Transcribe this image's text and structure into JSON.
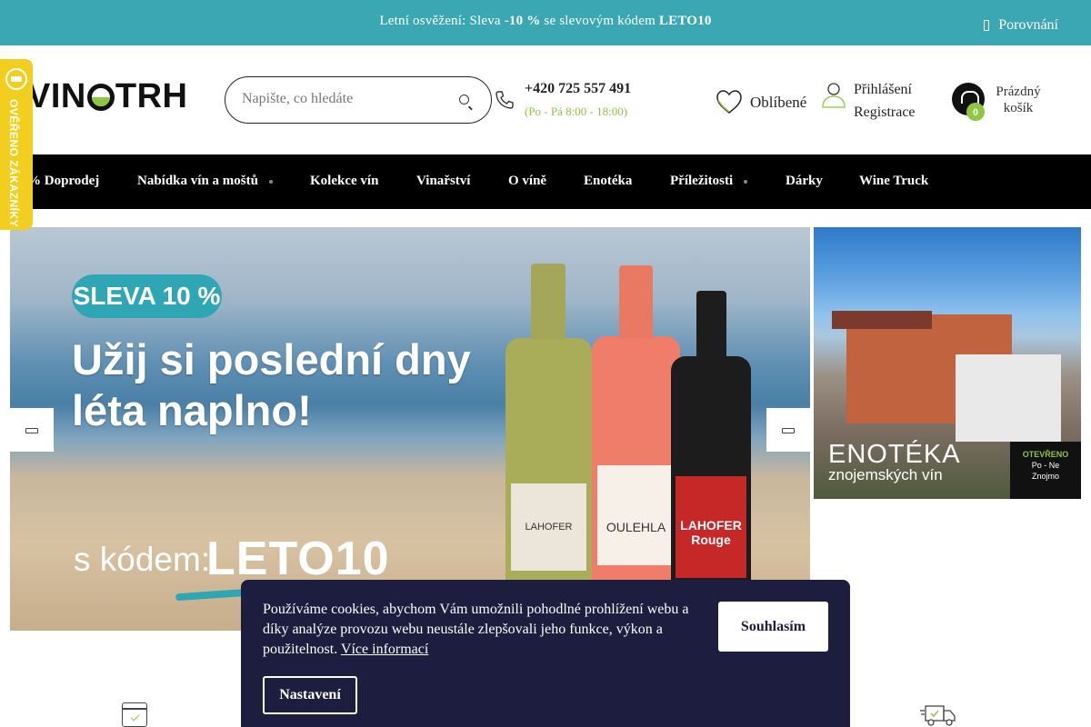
{
  "topbar": {
    "promo_text": "Letní osvěžení: Sleva ",
    "promo_discount": "-10 %",
    "promo_mid": " se slevovým kódem ",
    "promo_code": "LETO10",
    "compare_label": "Porovnání"
  },
  "badge": {
    "text": "OVĚŘENO ZÁKAZNÍKY"
  },
  "header": {
    "logo_left": "VIN",
    "logo_right": "TRH",
    "search_placeholder": "Napište, co hledáte",
    "phone": "+420 725 557 491",
    "hours": "(Po - Pá 8:00 - 18:00)",
    "favorites_label": "Oblíbené",
    "login_label": "Přihlášení",
    "register_label": "Registrace",
    "cart_count": "0",
    "cart_label": "Prázdný košík"
  },
  "nav": {
    "items": [
      {
        "label": "% Doprodej"
      },
      {
        "label": "Nabídka vín a moštů"
      },
      {
        "label": "Kolekce vín"
      },
      {
        "label": "Vinařství"
      },
      {
        "label": "O víně"
      },
      {
        "label": "Enotéka"
      },
      {
        "label": "Příležitosti"
      },
      {
        "label": "Dárky"
      },
      {
        "label": "Wine Truck"
      }
    ]
  },
  "hero": {
    "pill": "SLEVA 10 %",
    "headline": "Užij si poslední dny léta naplno!",
    "code_label": "s kódem:",
    "code": "LETO10",
    "bottles": [
      {
        "label": "LAHOFER"
      },
      {
        "label": "OULEHLA"
      },
      {
        "label": "LAHOFER Rouge"
      }
    ]
  },
  "side_banner": {
    "title": "ENOTÉKA",
    "subtitle": "znojemských vín",
    "open_line1": "OTEVŘENO",
    "open_line2": "Po - Ne",
    "open_line3": "Znojmo"
  },
  "cookie": {
    "text": "Používáme cookies, abychom Vám umožnili pohodlné prohlížení webu a díky analýze provozu webu neustále zlepšovali jeho funkce, výkon a použitelnost. ",
    "more_link": "Více informací",
    "agree_button": "Souhlasím",
    "settings_button": "Nastavení"
  },
  "colors": {
    "topbar": "#3aa7b3",
    "accent_green": "#8dc63f",
    "nav": "#000000",
    "cookie_bg": "#1d1d3f",
    "badge": "#f2cf1f"
  }
}
